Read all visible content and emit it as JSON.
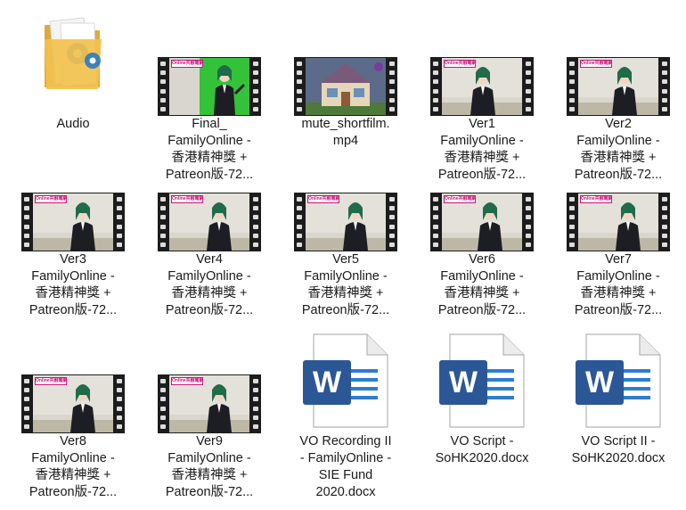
{
  "colors": {
    "word_blue": "#2b5797",
    "word_blue_light": "#2d7dd2",
    "folder_yellow": "#f2c14e",
    "logo_pink": "#d0157f",
    "green_screen": "#34c23a"
  },
  "thumbnail_logo_text": "Online共融電網台",
  "files": [
    {
      "name": "Audio",
      "type": "folder",
      "icon": "folder-icon"
    },
    {
      "name": "Final_\nFamilyOnline -\n香港精神獎 +\nPatreon版-72...",
      "type": "video",
      "icon": "video-thumbnail"
    },
    {
      "name": "mute_shortfilm.\nmp4",
      "type": "video",
      "icon": "video-thumbnail"
    },
    {
      "name": "Ver1\nFamilyOnline -\n香港精神獎 +\nPatreon版-72...",
      "type": "video",
      "icon": "video-thumbnail"
    },
    {
      "name": "Ver2\nFamilyOnline -\n香港精神獎 +\nPatreon版-72...",
      "type": "video",
      "icon": "video-thumbnail"
    },
    {
      "name": "Ver3\nFamilyOnline -\n香港精神獎 +\nPatreon版-72...",
      "type": "video",
      "icon": "video-thumbnail"
    },
    {
      "name": "Ver4\nFamilyOnline -\n香港精神獎 +\nPatreon版-72...",
      "type": "video",
      "icon": "video-thumbnail"
    },
    {
      "name": "Ver5\nFamilyOnline -\n香港精神獎 +\nPatreon版-72...",
      "type": "video",
      "icon": "video-thumbnail"
    },
    {
      "name": "Ver6\nFamilyOnline -\n香港精神獎 +\nPatreon版-72...",
      "type": "video",
      "icon": "video-thumbnail"
    },
    {
      "name": "Ver7\nFamilyOnline -\n香港精神獎 +\nPatreon版-72...",
      "type": "video",
      "icon": "video-thumbnail"
    },
    {
      "name": "Ver8\nFamilyOnline -\n香港精神獎 +\nPatreon版-72...",
      "type": "video",
      "icon": "video-thumbnail"
    },
    {
      "name": "Ver9\nFamilyOnline -\n香港精神獎 +\nPatreon版-72...",
      "type": "video",
      "icon": "video-thumbnail"
    },
    {
      "name": "VO Recording II\n- FamilyOnline -\nSIE Fund\n2020.docx",
      "type": "docx",
      "icon": "word-document-icon"
    },
    {
      "name": "VO Script -\nSoHK2020.docx",
      "type": "docx",
      "icon": "word-document-icon"
    },
    {
      "name": "VO Script II -\nSoHK2020.docx",
      "type": "docx",
      "icon": "word-document-icon"
    }
  ]
}
